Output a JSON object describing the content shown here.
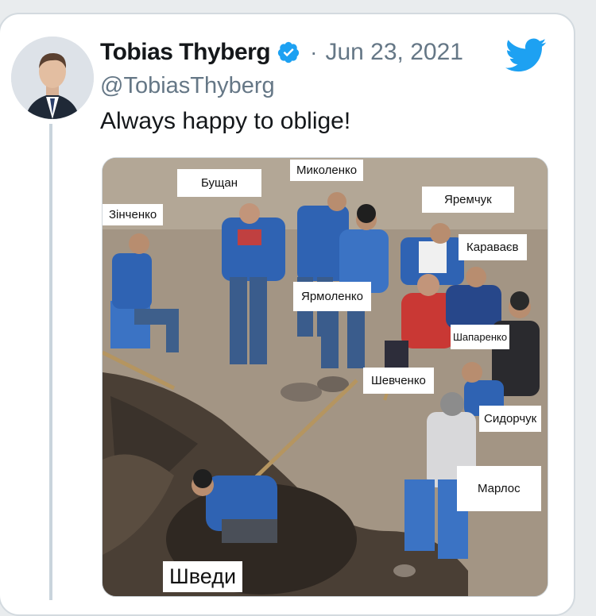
{
  "tweet": {
    "author_name": "Tobias Thyberg",
    "separator": "·",
    "date": "Jun 23, 2021",
    "handle": "@TobiasThyberg",
    "text": "Always happy to oblige!",
    "brand_color": "#1da1f2"
  },
  "media": {
    "labels": [
      "Зінченко",
      "Бущан",
      "Миколенко",
      "Яремчук",
      "Караваєв",
      "Ярмоленко",
      "Шапаренко",
      "Шевченко",
      "Сидорчук",
      "Марлос",
      "Шведи"
    ]
  }
}
